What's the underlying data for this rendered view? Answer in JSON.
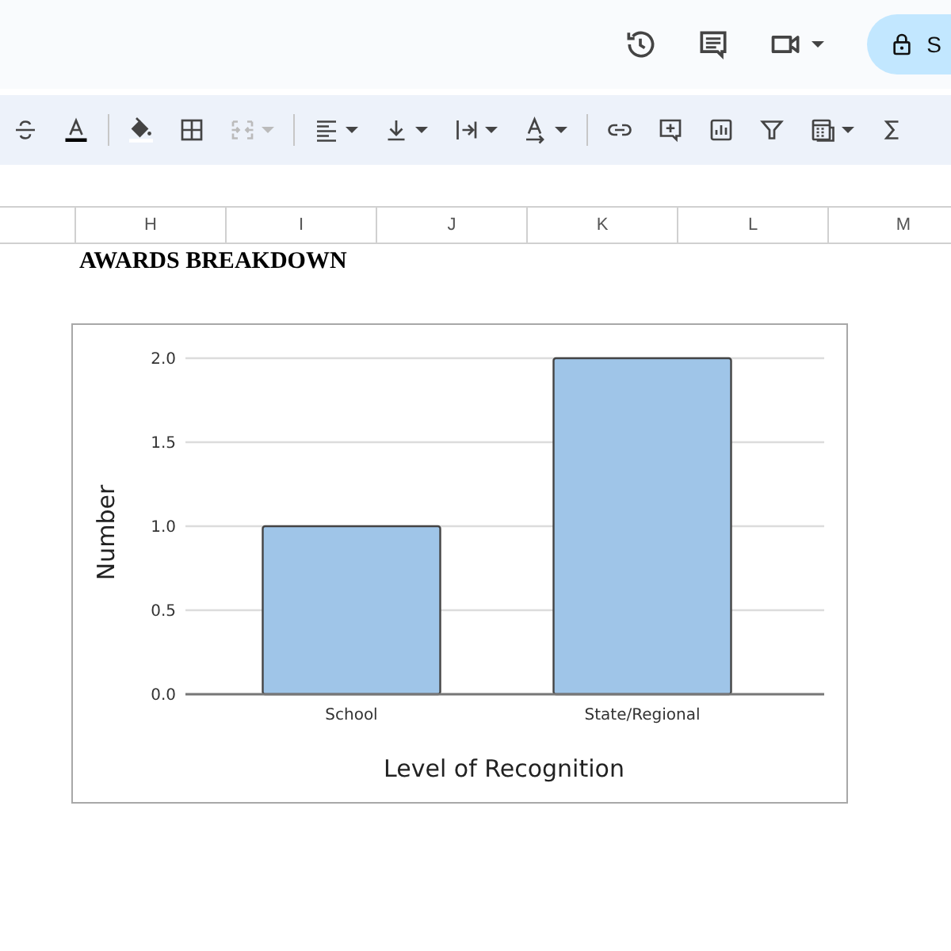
{
  "header": {
    "share_button": {
      "label": "S"
    }
  },
  "toolbar": {
    "buttons": [
      {
        "kind": "strikethrough",
        "disabled": false,
        "dropdown": false
      },
      {
        "kind": "text-color",
        "disabled": false,
        "dropdown": false
      },
      {
        "kind": "fill-color",
        "disabled": false,
        "dropdown": false
      },
      {
        "kind": "borders",
        "disabled": false,
        "dropdown": false
      },
      {
        "kind": "merge",
        "disabled": true,
        "dropdown": true
      },
      {
        "kind": "align",
        "disabled": false,
        "dropdown": true
      },
      {
        "kind": "valign",
        "disabled": false,
        "dropdown": true
      },
      {
        "kind": "wrap",
        "disabled": false,
        "dropdown": true
      },
      {
        "kind": "rotate",
        "disabled": false,
        "dropdown": true
      },
      {
        "kind": "link",
        "disabled": false,
        "dropdown": false
      },
      {
        "kind": "comment",
        "disabled": false,
        "dropdown": false
      },
      {
        "kind": "chart",
        "disabled": false,
        "dropdown": false
      },
      {
        "kind": "filter",
        "disabled": false,
        "dropdown": false
      },
      {
        "kind": "table",
        "disabled": false,
        "dropdown": true
      },
      {
        "kind": "sum",
        "disabled": false,
        "dropdown": false
      }
    ]
  },
  "columns": [
    "H",
    "I",
    "J",
    "K",
    "L",
    "M"
  ],
  "sheet_title": "AWARDS BREAKDOWN",
  "chart": {
    "chart_data": {
      "type": "bar",
      "xlabel": "Level of Recognition",
      "ylabel": "Number",
      "categories": [
        "School",
        "State/Regional"
      ],
      "series": [
        {
          "color": "#9fc5e8",
          "values": [
            1,
            2
          ]
        }
      ],
      "grid": true,
      "ylim": [
        0,
        2
      ],
      "yticks": [
        {
          "value": 0,
          "label": "0.0"
        },
        {
          "value": 0.5,
          "label": "0.5"
        },
        {
          "value": 1,
          "label": "1.0"
        },
        {
          "value": 1.5,
          "label": "1.5"
        },
        {
          "value": 2,
          "label": "2.0"
        }
      ]
    }
  }
}
